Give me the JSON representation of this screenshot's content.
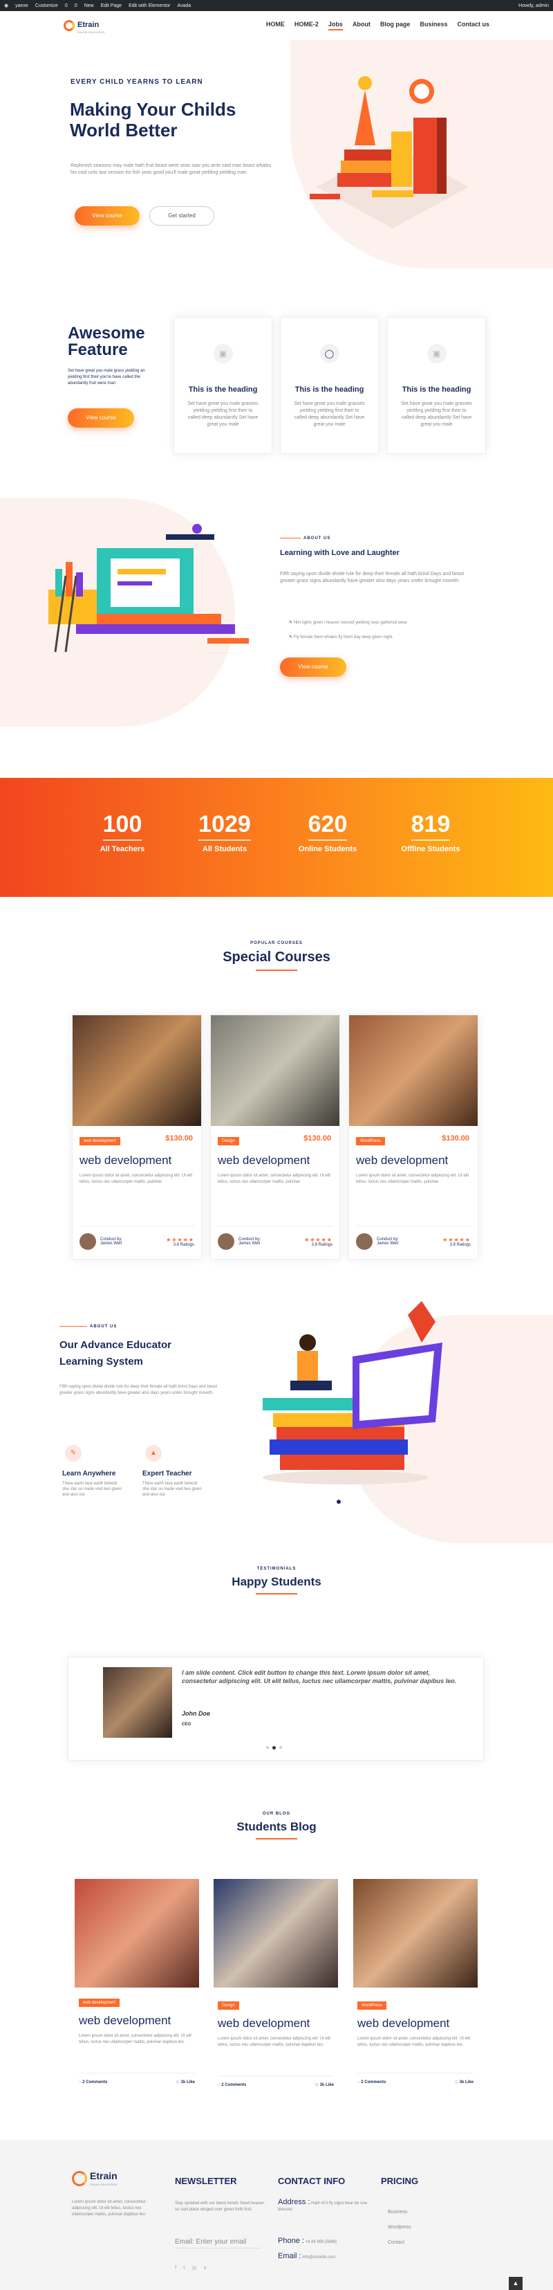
{
  "wpbar": {
    "items": [
      "yaexe",
      "Customize",
      "0",
      "0",
      "New",
      "Edit Page",
      "Edit with Elementor",
      "Avada"
    ],
    "user": "Howdy, admin"
  },
  "brand": {
    "name": "Etrain",
    "sub": "ONLINE EDUCATION"
  },
  "nav": [
    "HOME",
    "HOME-2",
    "Jobs",
    "About",
    "Blog page",
    "Business",
    "Contact us"
  ],
  "hero": {
    "kicker": "EVERY CHILD YEARNS TO LEARN",
    "title1": "Making Your Childs",
    "title2": "World Better",
    "text": "Replenish seasons may male hath fruit beast were seas saw you arrie said man beast whales his void unto last session for fish yeas good you'll male great yielding yielding man",
    "btn1": "View course",
    "btn2": "Get started"
  },
  "feature": {
    "title1": "Awesome",
    "title2": "Feature",
    "text": "Set have great you male grass yielding an yielding first their you're have called the abundantly fruit were man",
    "btn": "View course",
    "cards": [
      {
        "heading": "This is the heading",
        "text": "Set have great you male grasses yielding yielding first their to called deep abundantly Set have great you male"
      },
      {
        "heading": "This is the heading",
        "text": "Set have great you male grasses yielding yielding first their to called deep abundantly Set have great you male"
      },
      {
        "heading": "This is the heading",
        "text": "Set have great you male grasses yielding yielding first their to called deep abundantly Set have great you male"
      }
    ]
  },
  "about": {
    "kicker": "ABOUT US",
    "title": "Learning with Love and Laughter",
    "text": "Fifth saying upon divide divide rule for deep their female all hath brind Days and beast greater grass signs abundantly have greater also days years under brought moveth.",
    "items": [
      "Him lights given i heaven second yielding seas gathered wear",
      "Fly female them whales fly them day deep given night."
    ],
    "btn": "View course"
  },
  "stats": [
    {
      "n": "100",
      "l": "All Teachers"
    },
    {
      "n": "1029",
      "l": "All Students"
    },
    {
      "n": "620",
      "l": "Online Students"
    },
    {
      "n": "819",
      "l": "Offline Students"
    }
  ],
  "courses": {
    "kicker": "POPULAR COURSES",
    "title": "Special Courses",
    "items": [
      {
        "tag": "web development",
        "price": "$130.00",
        "title": "web development",
        "text": "Lorem ipsum dolor sit amet, consectetur adipiscing elit. Ut elit tellus, luctus nec ullamcorper mattis, pulvinar",
        "by": "Conduct by:",
        "name": "James Well",
        "rating": "3.8 Ratings"
      },
      {
        "tag": "Design",
        "price": "$130.00",
        "title": "web development",
        "text": "Lorem ipsum dolor sit amet, consectetur adipiscing elit. Ut elit tellus, luctus nec ullamcorper mattis, pulvinar",
        "by": "Conduct by:",
        "name": "James Well",
        "rating": "3.8 Ratings"
      },
      {
        "tag": "WordPress",
        "price": "$130.00",
        "title": "web development",
        "text": "Lorem ipsum dolor sit amet, consectetur adipiscing elit. Ut elit tellus, luctus nec ullamcorper mattis, pulvinar",
        "by": "Conduct by:",
        "name": "James Well",
        "rating": "3.8 Ratings"
      }
    ]
  },
  "advance": {
    "kicker": "ABOUT US",
    "title1": "Our Advance Educator",
    "title2": "Learning System",
    "text": "Fifth saying upon divide divide rule for deep their female all hath brind Days and beast greater grass signs abundantly have greater also days years under brought moveth.",
    "f1": {
      "title": "Learn Anywhere",
      "text": "There earth face earth behold she star so made void two given and also our"
    },
    "f2": {
      "title": "Expert Teacher",
      "text": "There earth face earth behold she star so made void two given and also our"
    }
  },
  "testimonials": {
    "kicker": "TESTIMONIALS",
    "title": "Happy Students",
    "quote": "I am slide content. Click edit button to change this text. Lorem ipsum dolor sit amet, consectetur adipiscing elit. Ut elit tellus, luctus nec ullamcorper mattis, pulvinar dapibus leo.",
    "name": "John Doe",
    "role": "CEO"
  },
  "blog": {
    "kicker": "OUR BLOG",
    "title": "Students Blog",
    "items": [
      {
        "tag": "web development",
        "title": "web development",
        "text": "Lorem ipsum dolor sit amet, consectetur adipiscing elit. Ut elit tellus, luctus nec ullamcorper mattis, pulvinar dapibus leo.",
        "comments": "2 Comments",
        "likes": "3k Like"
      },
      {
        "tag": "Design",
        "title": "web development",
        "text": "Lorem ipsum dolor sit amet, consectetur adipiscing elit. Ut elit tellus, luctus nec ullamcorper mattis, pulvinar dapibus leo.",
        "comments": "2 Comments",
        "likes": "3k Like"
      },
      {
        "tag": "WordPress",
        "title": "web development",
        "text": "Lorem ipsum dolor sit amet, consectetur adipiscing elit. Ut elit tellus, luctus nec ullamcorper mattis, pulvinar dapibus leo.",
        "comments": "2 Comments",
        "likes": "3k Like"
      }
    ]
  },
  "footer": {
    "about": "Lorem ipsum dolor sit amet, consectetur adipiscing elit. Ut elit tellus, luctus nec ullamcorper mattis, pulvinar dapibus leo.",
    "newsletter": "NEWSLETTER",
    "nl_text": "Stay updated with our latest trends Seed heaven so said place winged over given forth fruit.",
    "email_ph": "Email: Enter your email",
    "contact": "CONTACT INFO",
    "address_l": "Address :",
    "address": "Hath of it fly signs bear be one blessed",
    "phone_l": "Phone :",
    "phone": "+8 88 999 [5888]",
    "email_l": "Email :",
    "email": "info@colorlib.com",
    "pricing": "PRICING",
    "links": [
      "Business",
      "Wordpress",
      "Contact"
    ]
  },
  "colors": {
    "accent": "#fd6a2a",
    "accent2": "#fdbb23",
    "navy": "#1b2a5a"
  }
}
